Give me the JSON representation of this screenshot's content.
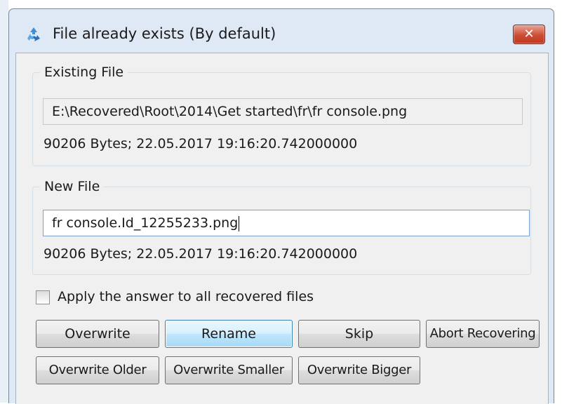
{
  "window": {
    "title": "File already exists (By default)",
    "icon": "recycle-icon",
    "close_icon": "close-icon",
    "close_glyph": "✕"
  },
  "existing_file": {
    "label": "Existing File",
    "path": "E:\\Recovered\\Root\\2014\\Get started\\fr\\fr console.png",
    "info": "90206 Bytes;  22.05.2017 19:16:20.742000000"
  },
  "new_file": {
    "label": "New File",
    "name_value": "fr console.Id_12255233.png",
    "info": "90206 Bytes;  22.05.2017 19:16:20.742000000"
  },
  "apply_all": {
    "label": "Apply the answer to all recovered files",
    "checked": false
  },
  "buttons": {
    "overwrite": "Overwrite",
    "rename": "Rename",
    "skip": "Skip",
    "abort": "Abort Recovering",
    "overwrite_older": "Overwrite Older",
    "overwrite_smaller": "Overwrite Smaller",
    "overwrite_bigger": "Overwrite Bigger"
  },
  "colors": {
    "titlebar": "#dfe9f5",
    "client": "#f0f0f0",
    "close_button": "#cc4c34",
    "default_button_border": "#3c7fb1"
  }
}
